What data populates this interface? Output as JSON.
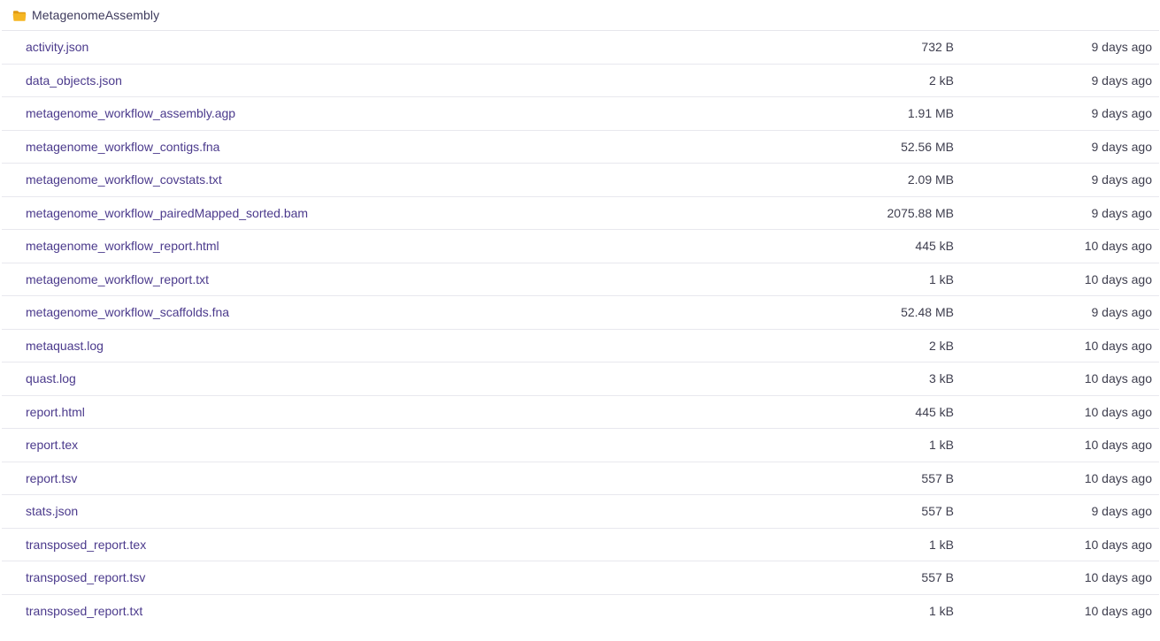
{
  "folder": {
    "name": "MetagenomeAssembly",
    "icon": "folder-icon",
    "icon_color": "#f5b623"
  },
  "files": [
    {
      "name": "activity.json",
      "size": "732 B",
      "modified": "9 days ago"
    },
    {
      "name": "data_objects.json",
      "size": "2 kB",
      "modified": "9 days ago"
    },
    {
      "name": "metagenome_workflow_assembly.agp",
      "size": "1.91 MB",
      "modified": "9 days ago"
    },
    {
      "name": "metagenome_workflow_contigs.fna",
      "size": "52.56 MB",
      "modified": "9 days ago"
    },
    {
      "name": "metagenome_workflow_covstats.txt",
      "size": "2.09 MB",
      "modified": "9 days ago"
    },
    {
      "name": "metagenome_workflow_pairedMapped_sorted.bam",
      "size": "2075.88 MB",
      "modified": "9 days ago"
    },
    {
      "name": "metagenome_workflow_report.html",
      "size": "445 kB",
      "modified": "10 days ago"
    },
    {
      "name": "metagenome_workflow_report.txt",
      "size": "1 kB",
      "modified": "10 days ago"
    },
    {
      "name": "metagenome_workflow_scaffolds.fna",
      "size": "52.48 MB",
      "modified": "9 days ago"
    },
    {
      "name": "metaquast.log",
      "size": "2 kB",
      "modified": "10 days ago"
    },
    {
      "name": "quast.log",
      "size": "3 kB",
      "modified": "10 days ago"
    },
    {
      "name": "report.html",
      "size": "445 kB",
      "modified": "10 days ago"
    },
    {
      "name": "report.tex",
      "size": "1 kB",
      "modified": "10 days ago"
    },
    {
      "name": "report.tsv",
      "size": "557 B",
      "modified": "10 days ago"
    },
    {
      "name": "stats.json",
      "size": "557 B",
      "modified": "9 days ago"
    },
    {
      "name": "transposed_report.tex",
      "size": "1 kB",
      "modified": "10 days ago"
    },
    {
      "name": "transposed_report.tsv",
      "size": "557 B",
      "modified": "10 days ago"
    },
    {
      "name": "transposed_report.txt",
      "size": "1 kB",
      "modified": "10 days ago"
    }
  ]
}
